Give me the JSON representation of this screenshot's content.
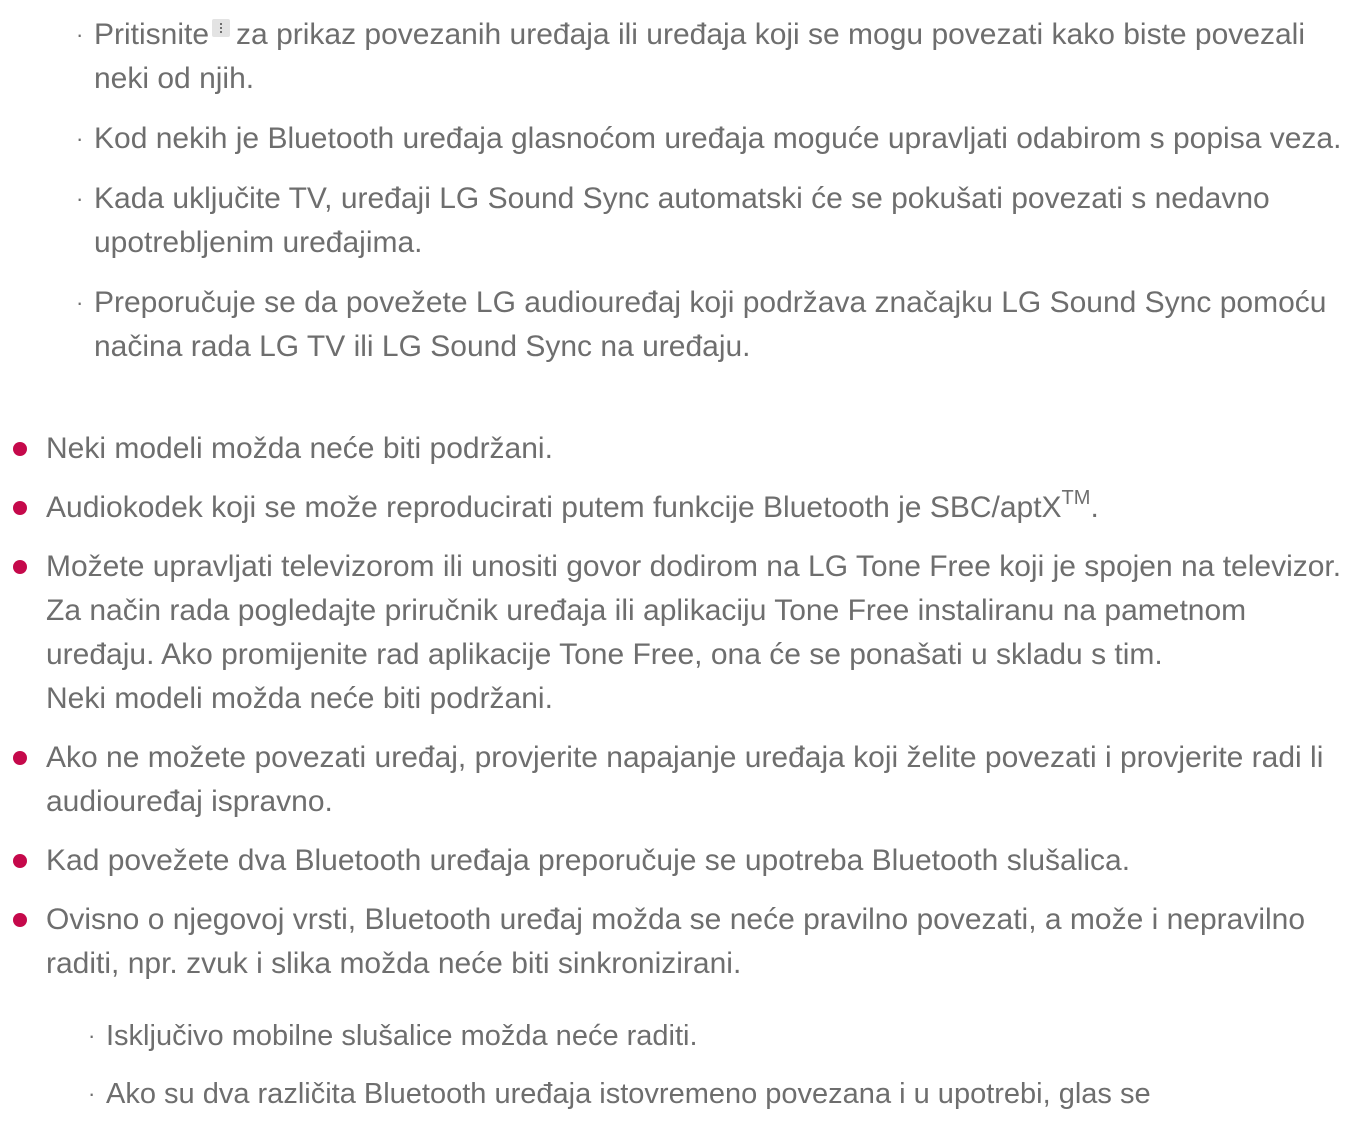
{
  "top_subitems": [
    {
      "before": "Pritisnite",
      "icon": "more-vertical-icon",
      "after": "za prikaz povezanih uređaja ili uređaja koji se mogu povezati kako biste povezali neki od njih."
    },
    {
      "text": "Kod nekih je Bluetooth uređaja glasnoćom uređaja moguće upravljati odabirom s popisa veza."
    },
    {
      "text": "Kada uključite TV, uređaji LG Sound Sync automatski će se pokušati povezati s nedavno upotrebljenim uređajima."
    },
    {
      "text": "Preporučuje se da povežete LG audiouređaj koji podržava značajku LG Sound Sync pomoću načina rada LG TV ili LG Sound Sync na uređaju."
    }
  ],
  "main_items": [
    {
      "text": "Neki modeli možda neće biti podržani."
    },
    {
      "text": "Audiokodek koji se može reproducirati putem funkcije Bluetooth je SBC/aptX",
      "sup": "TM",
      "after": "."
    },
    {
      "text": "Možete upravljati televizorom ili unositi govor dodirom na LG Tone Free koji je spojen na televizor.",
      "extra_1": "Za način rada pogledajte priručnik uređaja ili aplikaciju Tone Free instaliranu na pametnom uređaju. Ako promijenite rad aplikacije Tone Free, ona će se ponašati u skladu s tim.",
      "extra_2": "Neki modeli možda neće biti podržani."
    },
    {
      "text": "Ako ne možete povezati uređaj, provjerite napajanje uređaja koji želite povezati i provjerite radi li audiouređaj ispravno."
    },
    {
      "text": "Kad povežete dva Bluetooth uređaja preporučuje se upotreba Bluetooth slušalica."
    },
    {
      "text": "Ovisno o njegovoj vrsti, Bluetooth uređaj možda se neće pravilno povezati, a može i nepravilno raditi, npr. zvuk i slika možda neće biti sinkronizirani."
    }
  ],
  "bottom_subitems": [
    {
      "text": "Isključivo mobilne slušalice možda neće raditi."
    },
    {
      "text": "Ako su dva različita Bluetooth uređaja istovremeno povezana i u upotrebi, glas se"
    }
  ],
  "colors": {
    "text": "#6e6e6e",
    "bullet_accent": "#c5094b",
    "icon_bg": "#e3e3e3"
  }
}
